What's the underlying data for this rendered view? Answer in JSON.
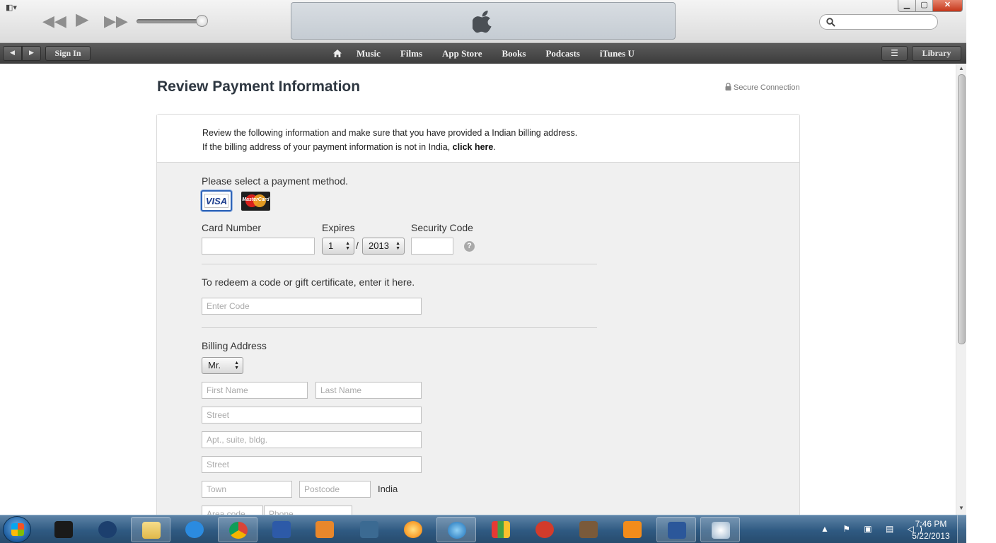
{
  "window": {
    "minimize_glyph": "▁",
    "maximize_glyph": "▢",
    "close_glyph": "✕",
    "menu_glyph": "◧▾"
  },
  "player": {
    "rewind_glyph": "◀◀",
    "play_glyph": "▶",
    "forward_glyph": "▶▶",
    "volume_level": 0.9
  },
  "search": {
    "placeholder": ""
  },
  "nav": {
    "back_glyph": "◀",
    "forward_glyph": "▶",
    "sign_in": "Sign In",
    "links": [
      "Music",
      "Films",
      "App Store",
      "Books",
      "Podcasts",
      "iTunes U"
    ],
    "list_glyph": "☰",
    "library": "Library"
  },
  "page": {
    "title": "Review Payment Information",
    "secure": "Secure Connection",
    "intro_line1": "Review the following information and make sure that you have provided a Indian billing address.",
    "intro_line2_prefix": "If the billing address of your payment information is not in India, ",
    "intro_link": "click here",
    "intro_line2_suffix": "."
  },
  "payment": {
    "prompt": "Please select a payment method.",
    "cards": [
      "VISA",
      "MasterCard"
    ],
    "selected_card": "VISA",
    "card_number_label": "Card Number",
    "card_number_value": "",
    "expires_label": "Expires",
    "expires_month": "1",
    "expires_separator": "/",
    "expires_year": "2013",
    "security_label": "Security Code",
    "security_value": "",
    "help_glyph": "?"
  },
  "redeem": {
    "prompt": "To redeem a code or gift certificate, enter it here.",
    "placeholder": "Enter Code"
  },
  "billing": {
    "label": "Billing Address",
    "salutation": "Mr.",
    "first_name_placeholder": "First Name",
    "last_name_placeholder": "Last Name",
    "street1_placeholder": "Street",
    "apt_placeholder": "Apt., suite, bldg.",
    "street2_placeholder": "Street",
    "town_placeholder": "Town",
    "postcode_placeholder": "Postcode",
    "country": "India",
    "area_code_placeholder": "Area code",
    "phone_placeholder": "Phone"
  },
  "taskbar": {
    "apps": [
      "blackberry",
      "chrome-alt",
      "file-explorer",
      "internet-explorer",
      "google-chrome",
      "messenger",
      "media-player",
      "kmplayer",
      "sun-app",
      "itunes",
      "office-app",
      "ccleaner",
      "game-app",
      "nero",
      "word",
      "paint"
    ],
    "tray_glyphs": "▲ ⚑ ▣ ▤ ◁)",
    "time": "7:46 PM",
    "date": "5/22/2013"
  },
  "colors": {
    "nav_bg": "#4b4b4b",
    "title": "#2e3741",
    "visa_blue": "#2f64b8",
    "panel_bg": "#f0f0f0"
  }
}
